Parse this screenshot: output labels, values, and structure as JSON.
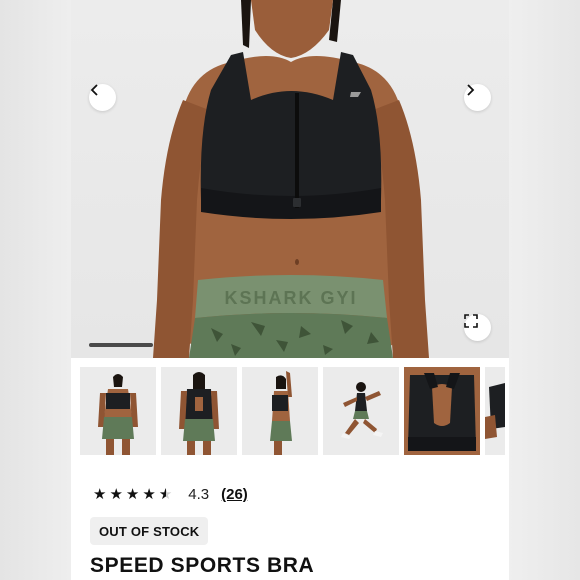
{
  "gallery": {
    "prev_icon": "chevron-left-icon",
    "next_icon": "chevron-right-icon",
    "expand_icon": "fullscreen-icon",
    "progress_fraction": 0.16,
    "waistband_text": "KSHARK GYI",
    "thumbnails": [
      {
        "name": "front-view",
        "active": true
      },
      {
        "name": "back-view",
        "active": false
      },
      {
        "name": "side-view",
        "active": false
      },
      {
        "name": "running-view",
        "active": false
      },
      {
        "name": "back-detail",
        "active": false
      },
      {
        "name": "partial-view",
        "active": false
      }
    ]
  },
  "product": {
    "rating_value": "4.3",
    "rating_stars": 4.3,
    "review_count": "(26)",
    "stock_status": "OUT OF STOCK",
    "title": "SPEED SPORTS BRA"
  },
  "colors": {
    "bra": "#1d1f22",
    "shorts": "#5f7a58",
    "skin": "#a0643f",
    "text": "#111111"
  }
}
